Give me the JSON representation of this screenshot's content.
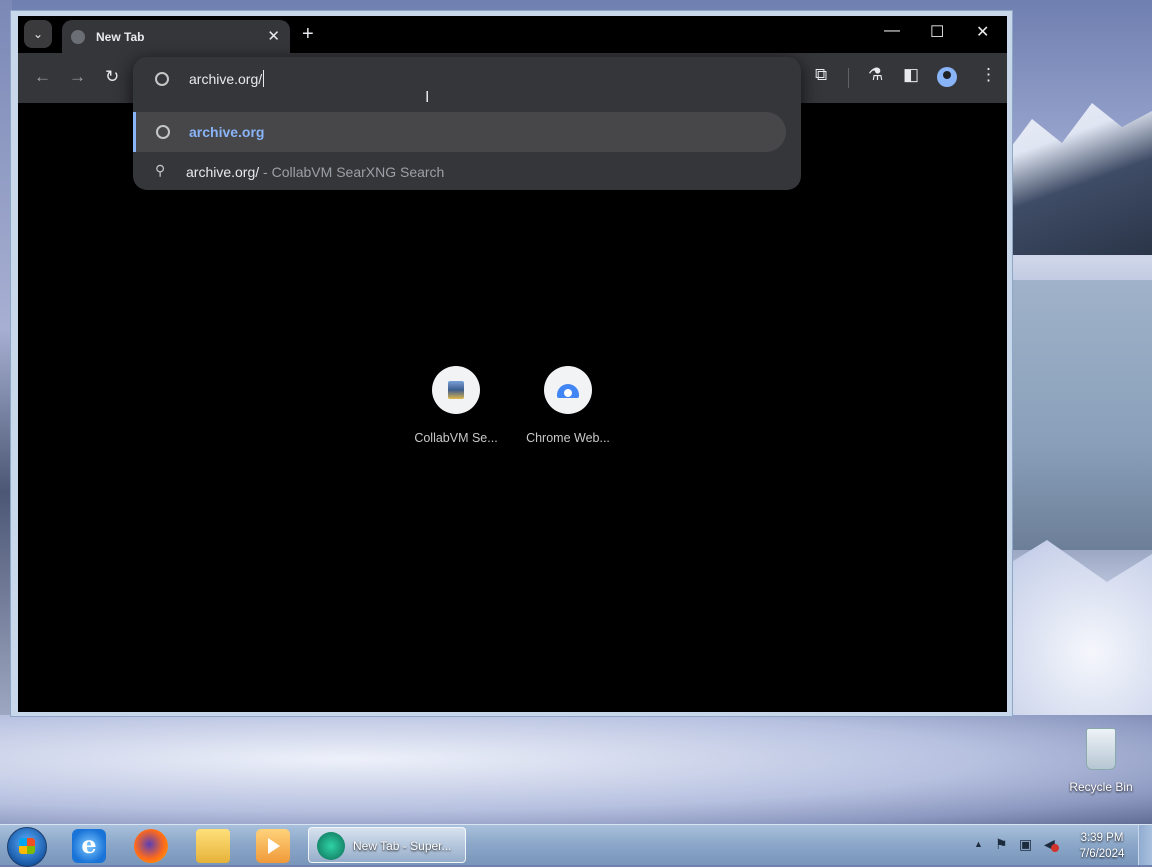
{
  "browser": {
    "tab": {
      "title": "New Tab"
    },
    "window_controls": {
      "minimize": "—",
      "maximize": "☐",
      "close": "✕"
    },
    "omnibox": {
      "value": "archive.org/",
      "suggestions": [
        {
          "text": "archive.org"
        },
        {
          "query": "archive.org/",
          "separator": "-",
          "engine": "CollabVM SearXNG Search"
        }
      ]
    },
    "shortcuts": [
      {
        "label": "CollabVM Se..."
      },
      {
        "label": "Chrome Web..."
      }
    ]
  },
  "desktop": {
    "recycle_bin_label": "Recycle Bin"
  },
  "taskbar": {
    "active_window_label": "New Tab - Super...",
    "clock_time": "3:39 PM",
    "clock_date": "7/6/2024"
  },
  "colors": {
    "accent": "#8ab4f8",
    "toolbar": "#35363a",
    "page_bg": "#000000"
  }
}
